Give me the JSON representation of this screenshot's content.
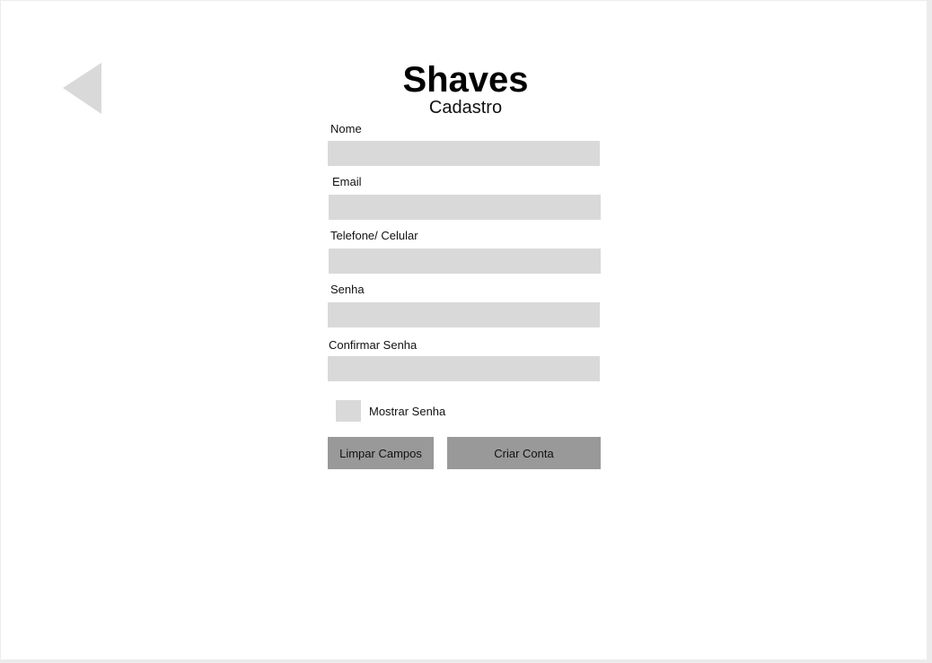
{
  "header": {
    "brand": "Shaves",
    "subtitle": "Cadastro",
    "back_icon": "back-triangle-icon"
  },
  "form": {
    "fields": [
      {
        "label": "Nome",
        "value": ""
      },
      {
        "label": "Email",
        "value": ""
      },
      {
        "label": "Telefone/ Celular",
        "value": ""
      },
      {
        "label": "Senha",
        "value": ""
      },
      {
        "label": "Confirmar Senha",
        "value": ""
      }
    ],
    "show_password_label": "Mostrar Senha",
    "show_password_checked": false,
    "clear_button_label": "Limpar Campos",
    "create_button_label": "Criar Conta"
  },
  "colors": {
    "input_fill": "#d9d9d9",
    "button_fill": "#999999",
    "icon_fill": "#d9d9d9"
  }
}
